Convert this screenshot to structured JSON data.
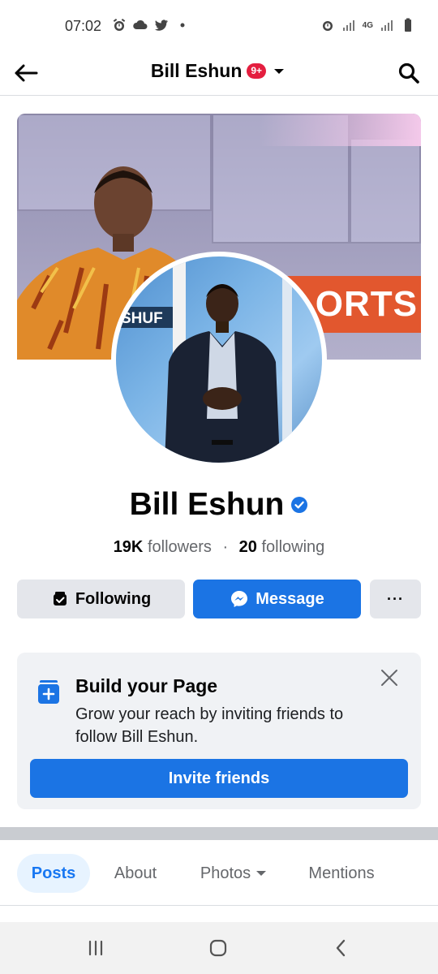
{
  "status_bar": {
    "time": "07:02",
    "left_icons": [
      "alarm-icon",
      "cloud-icon",
      "twitter-icon",
      "dot-icon"
    ],
    "right_icons": [
      "alarm-icon",
      "signal-icon",
      "4g-icon",
      "signal-icon",
      "battery-icon"
    ],
    "network_label": "4G"
  },
  "header": {
    "title": "Bill Eshun",
    "badge": "9+"
  },
  "cover": {
    "banner_text": "ORTS",
    "avatar_sign_text": "SHUF"
  },
  "profile": {
    "name": "Bill Eshun",
    "followers_count": "19K",
    "followers_label": "followers",
    "separator": "·",
    "following_count": "20",
    "following_label": "following"
  },
  "actions": {
    "following_label": "Following",
    "message_label": "Message",
    "more_label": "···"
  },
  "build_card": {
    "title": "Build your Page",
    "text": "Grow your reach by inviting friends to follow Bill Eshun.",
    "button_label": "Invite friends"
  },
  "tabs": [
    {
      "label": "Posts",
      "active": true
    },
    {
      "label": "About",
      "active": false
    },
    {
      "label": "Photos",
      "active": false
    },
    {
      "label": "Mentions",
      "active": false
    }
  ],
  "colors": {
    "brand_blue": "#1b74e4",
    "badge_red": "#e41e3f",
    "button_gray": "#e4e6eb",
    "card_bg": "#f0f2f5",
    "sports_orange": "#e2572e"
  }
}
